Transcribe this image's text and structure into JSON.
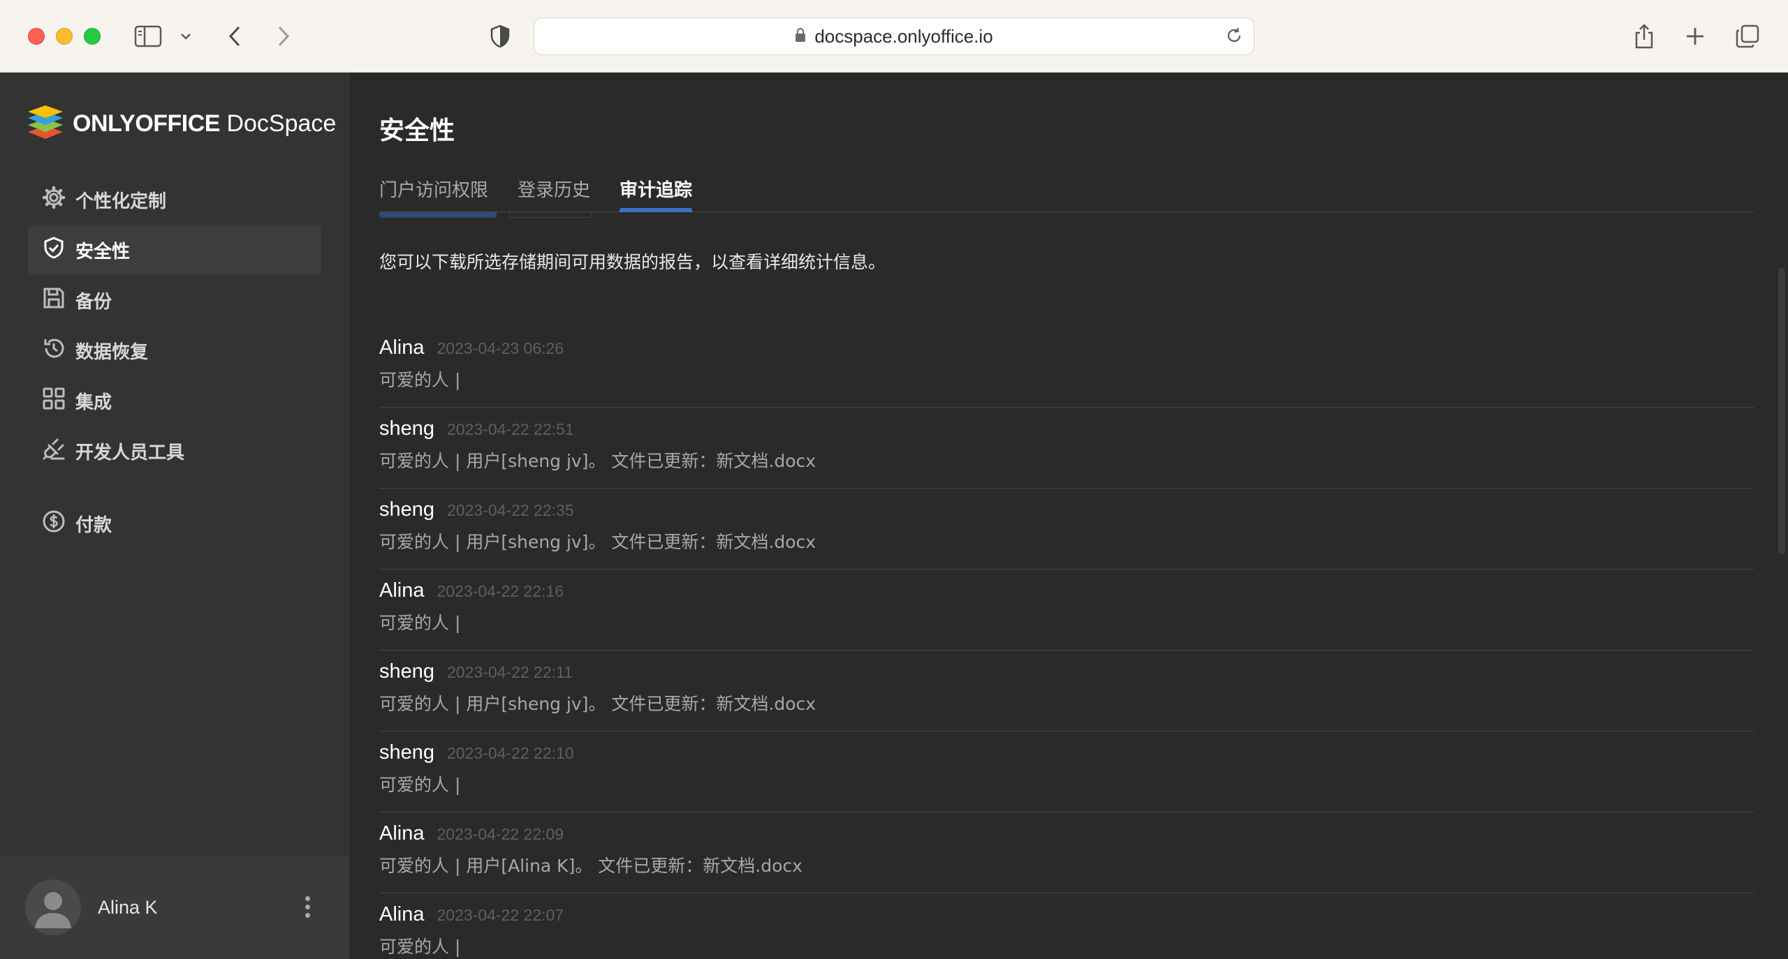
{
  "browser": {
    "url": "docspace.onlyoffice.io"
  },
  "app": {
    "logo_brand": "ONLYOFFICE",
    "logo_product": "DocSpace"
  },
  "sidebar": {
    "items": [
      {
        "label": "个性化定制",
        "icon": "gear-icon"
      },
      {
        "label": "安全性",
        "icon": "shield-icon",
        "active": true
      },
      {
        "label": "备份",
        "icon": "save-icon"
      },
      {
        "label": "数据恢复",
        "icon": "history-icon"
      },
      {
        "label": "集成",
        "icon": "grid-icon"
      },
      {
        "label": "开发人员工具",
        "icon": "plug-icon"
      }
    ],
    "payment": {
      "label": "付款",
      "icon": "dollar-icon"
    }
  },
  "user": {
    "name": "Alina K"
  },
  "main": {
    "title": "安全性",
    "tabs": [
      {
        "label": "门户访问权限"
      },
      {
        "label": "登录历史"
      },
      {
        "label": "审计追踪",
        "active": true
      }
    ],
    "description": "您可以下载所选存储期间可用数据的报告，以查看详细统计信息。",
    "entries": [
      {
        "user": "Alina",
        "time": "2023-04-23 06:26",
        "text": "可爱的人 |"
      },
      {
        "user": "sheng",
        "time": "2023-04-22 22:51",
        "text": "可爱的人 | 用户[sheng jv]。 文件已更新：新文档.docx"
      },
      {
        "user": "sheng",
        "time": "2023-04-22 22:35",
        "text": "可爱的人 | 用户[sheng jv]。 文件已更新：新文档.docx"
      },
      {
        "user": "Alina",
        "time": "2023-04-22 22:16",
        "text": "可爱的人 |"
      },
      {
        "user": "sheng",
        "time": "2023-04-22 22:11",
        "text": "可爱的人 | 用户[sheng jv]。 文件已更新：新文档.docx"
      },
      {
        "user": "sheng",
        "time": "2023-04-22 22:10",
        "text": "可爱的人 |"
      },
      {
        "user": "Alina",
        "time": "2023-04-22 22:09",
        "text": "可爱的人 | 用户[Alina K]。 文件已更新：新文档.docx"
      },
      {
        "user": "Alina",
        "time": "2023-04-22 22:07",
        "text": "可爱的人 |"
      }
    ]
  },
  "colors": {
    "accent": "#3b72c4",
    "sidebar_bg": "#333333",
    "main_bg": "#2a2a2a"
  }
}
